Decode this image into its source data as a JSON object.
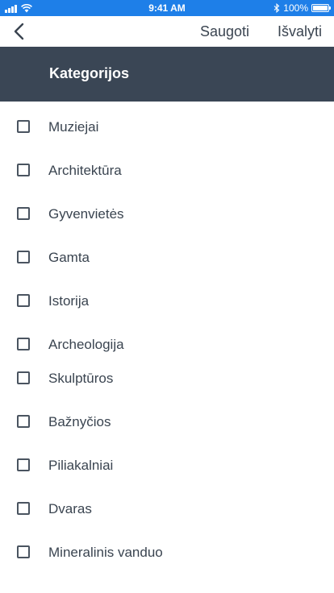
{
  "status_bar": {
    "time": "9:41 AM",
    "battery": "100%",
    "battery_level": 1.0
  },
  "navbar": {
    "back_icon": "chevron-left-icon",
    "save_label": "Saugoti",
    "clear_label": "Išvalyti"
  },
  "header": {
    "title": "Kategorijos"
  },
  "categories": [
    {
      "label": "Muziejai",
      "checked": false
    },
    {
      "label": "Architektūra",
      "checked": false
    },
    {
      "label": "Gyvenvietės",
      "checked": false
    },
    {
      "label": "Gamta",
      "checked": false
    },
    {
      "label": "Istorija",
      "checked": false
    },
    {
      "label": "Archeologija",
      "checked": false
    },
    {
      "label": "Skulptūros",
      "checked": false
    },
    {
      "label": "Bažnyčios",
      "checked": false
    },
    {
      "label": "Piliakalniai",
      "checked": false
    },
    {
      "label": "Dvaras",
      "checked": false
    },
    {
      "label": "Mineralinis vanduo",
      "checked": false
    }
  ],
  "colors": {
    "status_bar": "#1e7fe8",
    "header": "#3a4655",
    "text": "#3a4450"
  }
}
